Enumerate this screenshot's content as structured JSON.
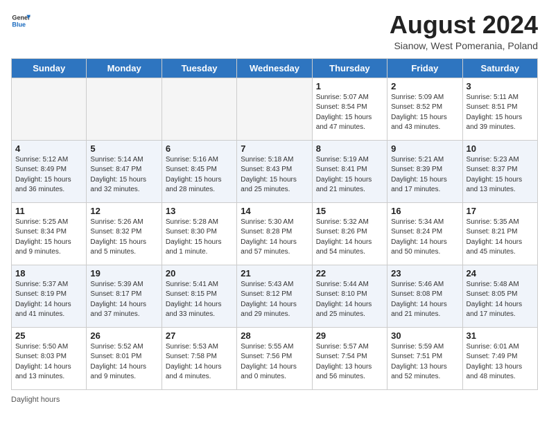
{
  "header": {
    "logo_general": "General",
    "logo_blue": "Blue",
    "title": "August 2024",
    "location": "Sianow, West Pomerania, Poland"
  },
  "days_of_week": [
    "Sunday",
    "Monday",
    "Tuesday",
    "Wednesday",
    "Thursday",
    "Friday",
    "Saturday"
  ],
  "weeks": [
    [
      {
        "day": "",
        "empty": true
      },
      {
        "day": "",
        "empty": true
      },
      {
        "day": "",
        "empty": true
      },
      {
        "day": "",
        "empty": true
      },
      {
        "day": "1",
        "sunrise": "5:07 AM",
        "sunset": "8:54 PM",
        "daylight": "15 hours and 47 minutes."
      },
      {
        "day": "2",
        "sunrise": "5:09 AM",
        "sunset": "8:52 PM",
        "daylight": "15 hours and 43 minutes."
      },
      {
        "day": "3",
        "sunrise": "5:11 AM",
        "sunset": "8:51 PM",
        "daylight": "15 hours and 39 minutes."
      }
    ],
    [
      {
        "day": "4",
        "sunrise": "5:12 AM",
        "sunset": "8:49 PM",
        "daylight": "15 hours and 36 minutes."
      },
      {
        "day": "5",
        "sunrise": "5:14 AM",
        "sunset": "8:47 PM",
        "daylight": "15 hours and 32 minutes."
      },
      {
        "day": "6",
        "sunrise": "5:16 AM",
        "sunset": "8:45 PM",
        "daylight": "15 hours and 28 minutes."
      },
      {
        "day": "7",
        "sunrise": "5:18 AM",
        "sunset": "8:43 PM",
        "daylight": "15 hours and 25 minutes."
      },
      {
        "day": "8",
        "sunrise": "5:19 AM",
        "sunset": "8:41 PM",
        "daylight": "15 hours and 21 minutes."
      },
      {
        "day": "9",
        "sunrise": "5:21 AM",
        "sunset": "8:39 PM",
        "daylight": "15 hours and 17 minutes."
      },
      {
        "day": "10",
        "sunrise": "5:23 AM",
        "sunset": "8:37 PM",
        "daylight": "15 hours and 13 minutes."
      }
    ],
    [
      {
        "day": "11",
        "sunrise": "5:25 AM",
        "sunset": "8:34 PM",
        "daylight": "15 hours and 9 minutes."
      },
      {
        "day": "12",
        "sunrise": "5:26 AM",
        "sunset": "8:32 PM",
        "daylight": "15 hours and 5 minutes."
      },
      {
        "day": "13",
        "sunrise": "5:28 AM",
        "sunset": "8:30 PM",
        "daylight": "15 hours and 1 minute."
      },
      {
        "day": "14",
        "sunrise": "5:30 AM",
        "sunset": "8:28 PM",
        "daylight": "14 hours and 57 minutes."
      },
      {
        "day": "15",
        "sunrise": "5:32 AM",
        "sunset": "8:26 PM",
        "daylight": "14 hours and 54 minutes."
      },
      {
        "day": "16",
        "sunrise": "5:34 AM",
        "sunset": "8:24 PM",
        "daylight": "14 hours and 50 minutes."
      },
      {
        "day": "17",
        "sunrise": "5:35 AM",
        "sunset": "8:21 PM",
        "daylight": "14 hours and 45 minutes."
      }
    ],
    [
      {
        "day": "18",
        "sunrise": "5:37 AM",
        "sunset": "8:19 PM",
        "daylight": "14 hours and 41 minutes."
      },
      {
        "day": "19",
        "sunrise": "5:39 AM",
        "sunset": "8:17 PM",
        "daylight": "14 hours and 37 minutes."
      },
      {
        "day": "20",
        "sunrise": "5:41 AM",
        "sunset": "8:15 PM",
        "daylight": "14 hours and 33 minutes."
      },
      {
        "day": "21",
        "sunrise": "5:43 AM",
        "sunset": "8:12 PM",
        "daylight": "14 hours and 29 minutes."
      },
      {
        "day": "22",
        "sunrise": "5:44 AM",
        "sunset": "8:10 PM",
        "daylight": "14 hours and 25 minutes."
      },
      {
        "day": "23",
        "sunrise": "5:46 AM",
        "sunset": "8:08 PM",
        "daylight": "14 hours and 21 minutes."
      },
      {
        "day": "24",
        "sunrise": "5:48 AM",
        "sunset": "8:05 PM",
        "daylight": "14 hours and 17 minutes."
      }
    ],
    [
      {
        "day": "25",
        "sunrise": "5:50 AM",
        "sunset": "8:03 PM",
        "daylight": "14 hours and 13 minutes."
      },
      {
        "day": "26",
        "sunrise": "5:52 AM",
        "sunset": "8:01 PM",
        "daylight": "14 hours and 9 minutes."
      },
      {
        "day": "27",
        "sunrise": "5:53 AM",
        "sunset": "7:58 PM",
        "daylight": "14 hours and 4 minutes."
      },
      {
        "day": "28",
        "sunrise": "5:55 AM",
        "sunset": "7:56 PM",
        "daylight": "14 hours and 0 minutes."
      },
      {
        "day": "29",
        "sunrise": "5:57 AM",
        "sunset": "7:54 PM",
        "daylight": "13 hours and 56 minutes."
      },
      {
        "day": "30",
        "sunrise": "5:59 AM",
        "sunset": "7:51 PM",
        "daylight": "13 hours and 52 minutes."
      },
      {
        "day": "31",
        "sunrise": "6:01 AM",
        "sunset": "7:49 PM",
        "daylight": "13 hours and 48 minutes."
      }
    ]
  ],
  "footer": {
    "daylight_hours": "Daylight hours"
  }
}
